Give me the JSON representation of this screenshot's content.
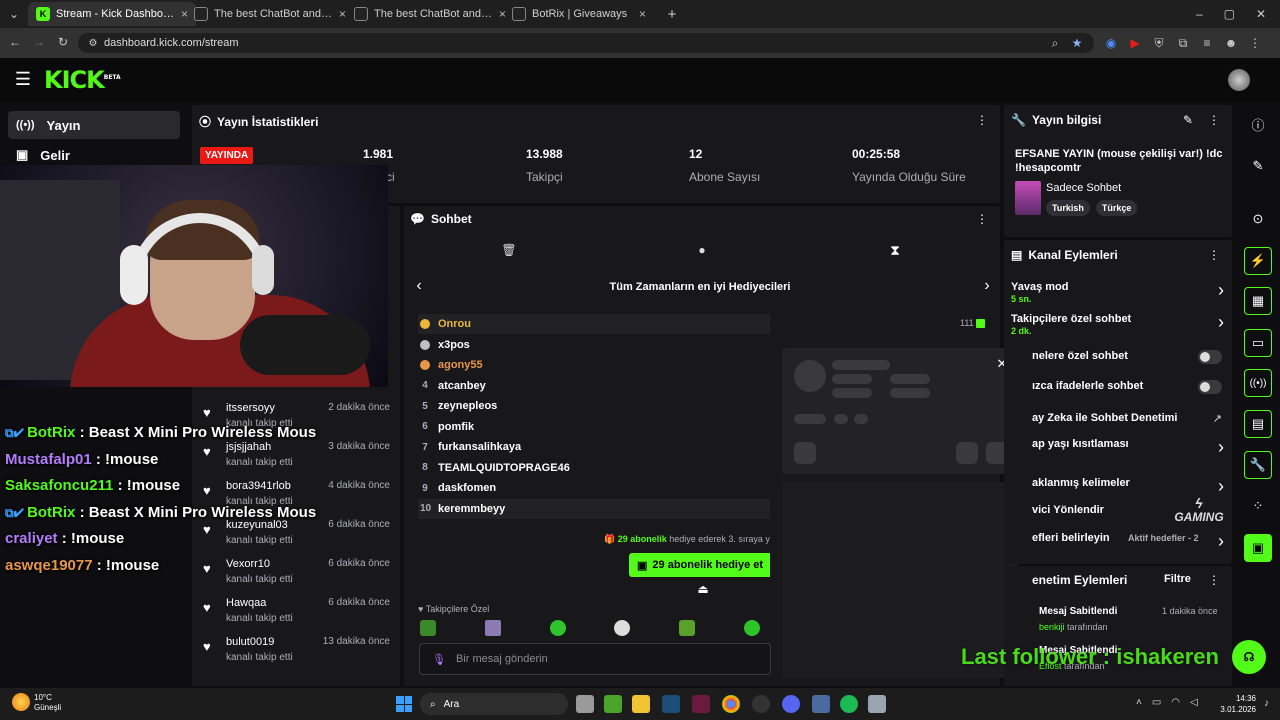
{
  "browser": {
    "tabs": [
      {
        "title": "Stream - Kick Dashboard"
      },
      {
        "title": "The best ChatBot and Widg"
      },
      {
        "title": "The best ChatBot and Widgets"
      },
      {
        "title": "BotRix | Giveaways"
      }
    ],
    "url": "dashboard.kick.com/stream"
  },
  "app": {
    "logo": "KICK",
    "beta": "BETA"
  },
  "sidebar": {
    "items": [
      {
        "label": "Yayın"
      },
      {
        "label": "Gelir"
      }
    ]
  },
  "stats": {
    "title": "Yayın İstatistikleri",
    "live_badge": "YAYINDA",
    "items": [
      {
        "value": "1.981",
        "label": "İzleyici",
        "visible_label": "ci"
      },
      {
        "value": "13.988",
        "label": "Takipçi"
      },
      {
        "value": "12",
        "label": "Abone Sayısı"
      },
      {
        "value": "00:25:58",
        "label": "Yayında Olduğu Süre"
      }
    ]
  },
  "info": {
    "title": "Yayın bilgisi",
    "stream_title": "EFSANE YAYIN (mouse çekilişi var!) !dc !hesapcomtr",
    "category": "Sadece Sohbet",
    "tags": [
      "Turkish",
      "Türkçe"
    ]
  },
  "chat": {
    "title": "Sohbet",
    "leaderboard_title": "Tüm Zamanların en iyi Hediyecileri",
    "gifters": [
      {
        "rank": "1",
        "name": "Onrou",
        "count": "111",
        "color": "#e8b83a"
      },
      {
        "rank": "2",
        "name": "x3pos",
        "color": "#ffffff"
      },
      {
        "rank": "3",
        "name": "agony55",
        "color": "#e8964a"
      },
      {
        "rank": "4",
        "name": "atcanbey",
        "color": "#ffffff"
      },
      {
        "rank": "5",
        "name": "zeynepleos",
        "color": "#ffffff"
      },
      {
        "rank": "6",
        "name": "pomfik",
        "color": "#ffffff"
      },
      {
        "rank": "7",
        "name": "furkansalihkaya",
        "color": "#ffffff"
      },
      {
        "rank": "8",
        "name": "TEAMLQUIDTOPRAGE46",
        "color": "#ffffff"
      },
      {
        "rank": "9",
        "name": "daskfomen",
        "color": "#ffffff"
      },
      {
        "rank": "10",
        "name": "keremmbeyy",
        "color": "#ffffff"
      }
    ],
    "gift_line_count": "29 abonelik",
    "gift_line_text": "hediye ederek 3. sıraya y",
    "gift_button": "29 abonelik hediye et",
    "followers_only": "Takipçilere Özel",
    "input_placeholder": "Bir mesaj gönderin"
  },
  "followers": [
    {
      "name": "itssersoyy",
      "action": "kanalı takip etti",
      "time": "2 dakika önce"
    },
    {
      "name": "jsjsjjahah",
      "action": "kanalı takip etti",
      "time": "3 dakika önce"
    },
    {
      "name": "bora3941rlob",
      "action": "kanalı takip etti",
      "time": "4 dakika önce"
    },
    {
      "name": "kuzeyunal03",
      "action": "kanalı takip etti",
      "time": "6 dakika önce"
    },
    {
      "name": "Vexorr10",
      "action": "kanalı takip etti",
      "time": "6 dakika önce"
    },
    {
      "name": "Hawqaa",
      "action": "kanalı takip etti",
      "time": "6 dakika önce"
    },
    {
      "name": "bulut0019",
      "action": "kanalı takip etti",
      "time": "13 dakika önce"
    }
  ],
  "overlay_chat": [
    {
      "user": "BotRix",
      "msg": " : Beast X Mini Pro Wireless Mous",
      "color": "#53fc18"
    },
    {
      "user": "Mustafalp01",
      "msg": " : !mouse",
      "color": "#b57bff"
    },
    {
      "user": "Saksafoncu211",
      "msg": " : !mouse",
      "color": "#53fc18"
    },
    {
      "user": "BotRix",
      "msg": " : Beast X Mini Pro Wireless Mous",
      "color": "#53fc18"
    },
    {
      "user": "craliyet",
      "msg": " : !mouse",
      "color": "#b57bff"
    },
    {
      "user": "aswqe19077",
      "msg": " : !mouse",
      "color": "#e8964a"
    }
  ],
  "channel": {
    "title": "Kanal Eylemleri",
    "items": [
      {
        "label": "Yavaş mod",
        "sub": "5 sn."
      },
      {
        "label": "Takipçilere özel sohbet",
        "sub": "2 dk."
      },
      {
        "label": "nelere özel sohbet"
      },
      {
        "label": "ızca ifadelerle sohbet"
      },
      {
        "label": "ay Zeka ile Sohbet Denetimi"
      },
      {
        "label": "ap yaşı kısıtlaması"
      },
      {
        "label": "aklanmış kelimeler"
      },
      {
        "label": "vici Yönlendir"
      },
      {
        "label": "efleri belirleyin",
        "sub": "Aktif hedefler - 2"
      }
    ]
  },
  "mod": {
    "title": "enetim Eylemleri",
    "filter": "Filtre",
    "items": [
      {
        "label": "Mesaj Sabitlendi",
        "by": "benkiji",
        "by_suffix": "tarafından",
        "time": "1 dakika önce"
      },
      {
        "label": "Mesaj Sabitlendi",
        "by": "Eflost",
        "by_suffix": "tarafından"
      }
    ]
  },
  "overlay_follower": "Last follower : ishakeren",
  "gaming_logo": "GAMING",
  "taskbar": {
    "weather_temp": "10°C",
    "weather_desc": "Güneşli",
    "search": "Ara",
    "time": "14:36",
    "date": "3.01.2026"
  },
  "colors": {
    "accent": "#53fc18",
    "live": "#e91916",
    "panel": "#18181b"
  }
}
